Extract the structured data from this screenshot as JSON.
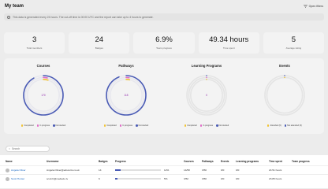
{
  "header": {
    "title": "My team",
    "open_menu_label": "Open filters"
  },
  "notice": {
    "text": "This data is generated every 24 hours. The cut-off time is 00:00 UTC and the report can take up to 4 hours to generate."
  },
  "stats": [
    {
      "value": "3",
      "label": "Total members"
    },
    {
      "value": "24",
      "label": "Badges"
    },
    {
      "value": "6.9%",
      "label": "Team progress"
    },
    {
      "value": "49.34 hours",
      "label": "Time spent"
    },
    {
      "value": "5",
      "label": "Average rating"
    }
  ],
  "charts": {
    "courses": {
      "title": "Courses",
      "center": "170"
    },
    "pathways": {
      "title": "Pathways",
      "center": "115"
    },
    "learning_programs": {
      "title": "Learning Programs",
      "center": "0"
    },
    "events": {
      "title": "Events"
    }
  },
  "legend": {
    "completed": "Completed",
    "in_progress": "In progress",
    "not_started": "Not started",
    "attended": "Attended (0)",
    "not_attended": "Not attended (0)"
  },
  "colors": {
    "completed": "#f1c232",
    "in_progress": "#e06bc7",
    "not_started": "#4a5bb5",
    "primary_link": "#1565c0"
  },
  "chart_data": [
    {
      "type": "pie",
      "title": "Courses",
      "categories": [
        "Completed",
        "In progress",
        "Not started"
      ],
      "values": [
        8,
        6,
        156
      ]
    },
    {
      "type": "pie",
      "title": "Pathways",
      "categories": [
        "Completed",
        "In progress",
        "Not started"
      ],
      "values": [
        4,
        3,
        108
      ]
    },
    {
      "type": "pie",
      "title": "Learning Programs",
      "categories": [
        "Completed",
        "In progress",
        "Not started"
      ],
      "values": [
        0,
        0,
        0
      ]
    },
    {
      "type": "pie",
      "title": "Events",
      "categories": [
        "Attended",
        "Not attended"
      ],
      "values": [
        0,
        0
      ]
    }
  ],
  "search": {
    "placeholder": "Search"
  },
  "table": {
    "headers": [
      "Name",
      "Username",
      "Badges",
      "Progress",
      "Courses",
      "Pathways",
      "Events",
      "Learning programs",
      "Time spent",
      "Team progress"
    ],
    "rows": [
      {
        "name": "Angela Oliver",
        "username": "Angela.Oliver@edscorts.co.uk",
        "badges": "14",
        "progress": 0.12,
        "progress_label": "12%",
        "courses": "14/58",
        "pathways": "3/50",
        "events": "0/0",
        "learning_programs": "0/0",
        "time_spent": "24.51 hours",
        "team_progress": ""
      },
      {
        "name": "Scott Hunter",
        "username": "scott.h@medavio.tv",
        "badges": "6",
        "progress": 0.05,
        "progress_label": "5%",
        "courses": "3/52",
        "pathways": "3/50",
        "events": "0/0",
        "learning_programs": "0/0",
        "time_spent": "23.85 hours",
        "team_progress": ""
      }
    ]
  }
}
